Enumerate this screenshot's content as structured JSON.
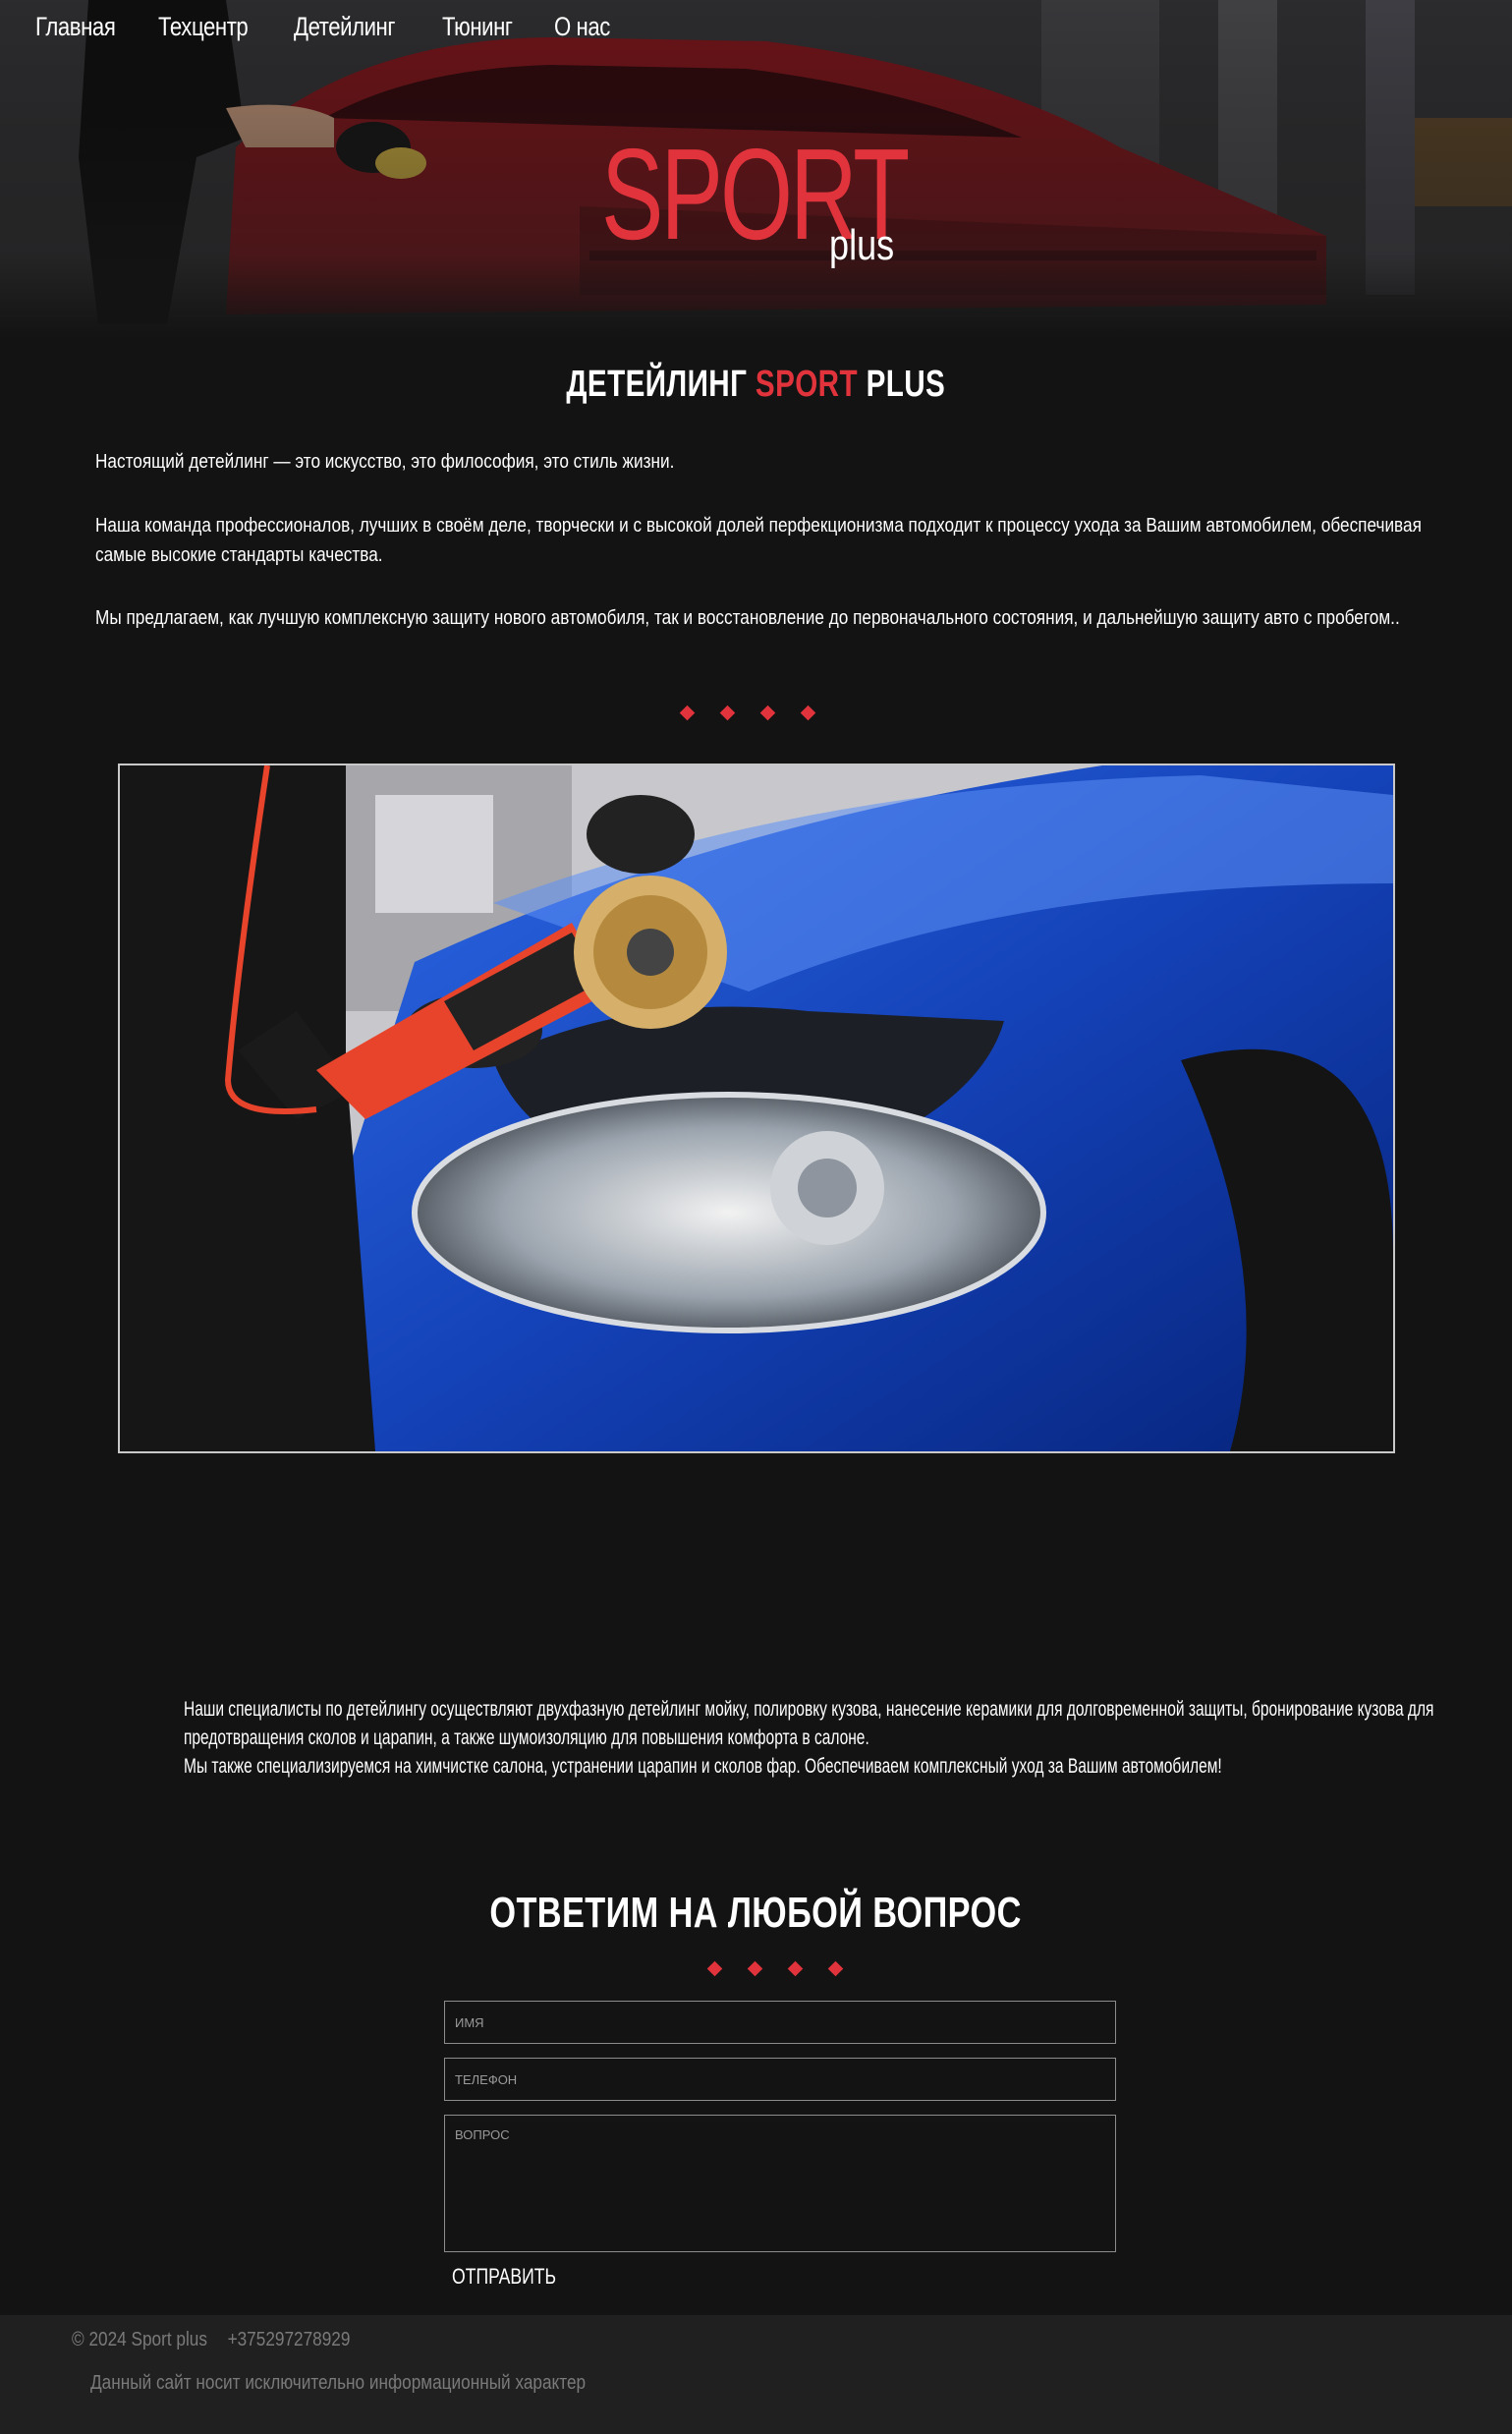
{
  "nav": {
    "items": [
      "Главная",
      "Техцентр",
      "Детейлинг",
      "Тюнинг",
      "О нас"
    ]
  },
  "logo": {
    "main": "SPORT",
    "sub": "plus"
  },
  "detailing": {
    "title_part1": "ДЕТЕЙЛИНГ ",
    "title_accent": "SPORT",
    "title_part2": " PLUS",
    "paragraphs": [
      "Настоящий детейлинг — это искусство, это философия, это стиль жизни.",
      "Наша команда профессионалов, лучших в своём деле, творчески и с высокой долей перфекционизма подходит к процессу ухода за Вашим автомобилем, обеспечивая самые высокие стандарты качества.",
      "Мы предлагаем, как лучшую комплексную защиту нового автомобиля, так и восстановление до первоначального состояния, и дальнейшую защиту авто с пробегом.."
    ]
  },
  "services": {
    "line1": "Наши специалисты по детейлингу осуществляют двухфазную детейлинг мойку, полировку кузова, нанесение керамики для долговременной защиты, бронирование кузова для предотвращения сколов и царапин, а также шумоизоляцию для повышения комфорта в салоне.",
    "line2": "Мы также специализируемся на химчистке салона, устранении царапин и сколов фар. Обеспечиваем комплексный уход за Вашим автомобилем!"
  },
  "form": {
    "title": "ОТВЕТИМ НА ЛЮБОЙ ВОПРОС",
    "name_placeholder": "ИМЯ",
    "phone_placeholder": "ТЕЛЕФОН",
    "question_placeholder": "ВОПРОС",
    "submit_label": "ОТПРАВИТЬ"
  },
  "footer": {
    "copyright": "© 2024 Sport plus",
    "phone": "+375297278929",
    "disclaimer": "Данный сайт носит исключительно информационный характер"
  },
  "colors": {
    "accent": "#e0333c",
    "background": "#131313",
    "footer": "#202020"
  }
}
